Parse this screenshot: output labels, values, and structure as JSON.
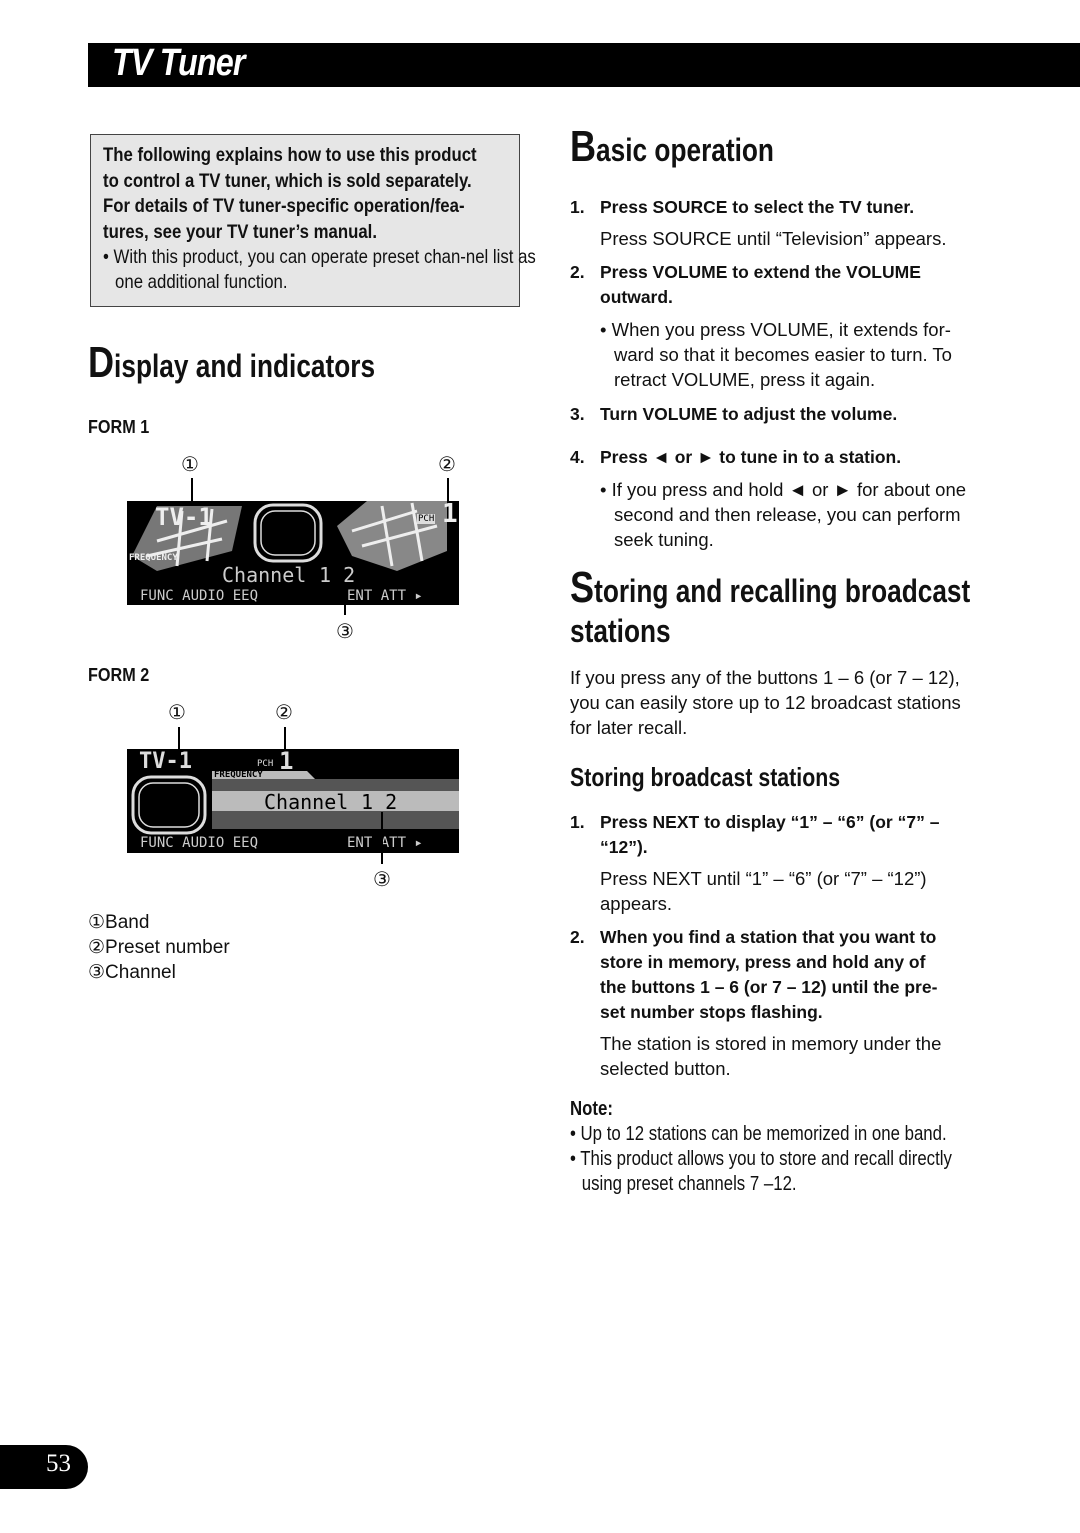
{
  "header": {
    "title": "TV Tuner"
  },
  "intro": {
    "bold_lines": [
      "The following explains how to use this product",
      "to control a TV tuner, which is sold separately.",
      "For details of TV tuner-specific operation/fea-",
      "tures, see your TV tuner’s manual."
    ],
    "bullet": "• With this product, you can operate preset chan-nel list as one additional function."
  },
  "display_section": {
    "heading_cap": "D",
    "heading_rest": "isplay and indicators",
    "forms": [
      {
        "label": "FORM 1",
        "band": "TV-1",
        "preset_label": "PCH",
        "preset": "1",
        "freq_label": "FREQUENCY",
        "channel_text": "Channel",
        "channel_num": "1 2",
        "func_keys": "FUNC AUDIO EEQ",
        "right_keys": "ENT ATT ▸",
        "markers": [
          "①",
          "②",
          "③"
        ]
      },
      {
        "label": "FORM 2",
        "band": "TV-1",
        "preset_label": "PCH",
        "preset": "1",
        "freq_label": "FREQUENCY",
        "channel_text": "Channel",
        "channel_num": "1 2",
        "func_keys": "FUNC AUDIO EEQ",
        "right_keys": "ENT ATT ▸",
        "markers": [
          "①",
          "②",
          "③"
        ]
      }
    ],
    "legend": [
      "①Band",
      "②Preset number",
      "③Channel"
    ]
  },
  "basic_operation": {
    "heading_cap": "B",
    "heading_rest": "asic operation",
    "steps": [
      {
        "num": "1.",
        "title": "Press SOURCE to select the TV tuner.",
        "body": "Press SOURCE until “Television” appears."
      },
      {
        "num": "2.",
        "title_lines": [
          "Press VOLUME to extend the VOLUME",
          "outward."
        ],
        "bullet_lines": [
          "• When you press VOLUME, it extends for-",
          "ward so that it becomes easier to turn. To",
          "retract VOLUME, press it again."
        ]
      },
      {
        "num": "3.",
        "title": "Turn VOLUME to adjust the volume."
      },
      {
        "num": "4.",
        "title": "Press ◄ or ► to tune in to a station.",
        "bullet_lines": [
          "• If you press and hold ◄ or ► for about one",
          "second and then release, you can perform",
          "seek tuning."
        ]
      }
    ]
  },
  "storing_section": {
    "heading_cap": "S",
    "heading_line1_rest": "toring and recalling broadcast",
    "heading_line2": "stations",
    "intro_lines": [
      "If you press any of the buttons 1 – 6 (or 7 – 12),",
      "you can easily store up to 12 broadcast stations",
      "for later recall."
    ],
    "subheading": "Storing broadcast stations",
    "steps": [
      {
        "num": "1.",
        "title_lines": [
          "Press NEXT to display “1” – “6” (or “7” –",
          "“12”)."
        ],
        "body_lines": [
          "Press NEXT until “1” – “6” (or “7” – “12”)",
          "appears."
        ]
      },
      {
        "num": "2.",
        "title_lines": [
          "When you find a station that you want to",
          "store in memory, press and hold any of",
          "the buttons 1 – 6 (or 7 – 12) until the pre-",
          "set number stops flashing."
        ],
        "body_lines": [
          "The station is stored in memory under the",
          "selected button."
        ]
      }
    ],
    "note_label": "Note:",
    "notes": [
      "• Up to 12 stations can be memorized in one band.",
      "• This product allows you to store and recall directly",
      "using preset channels 7 –12."
    ]
  },
  "footer": {
    "page_number": "53"
  }
}
